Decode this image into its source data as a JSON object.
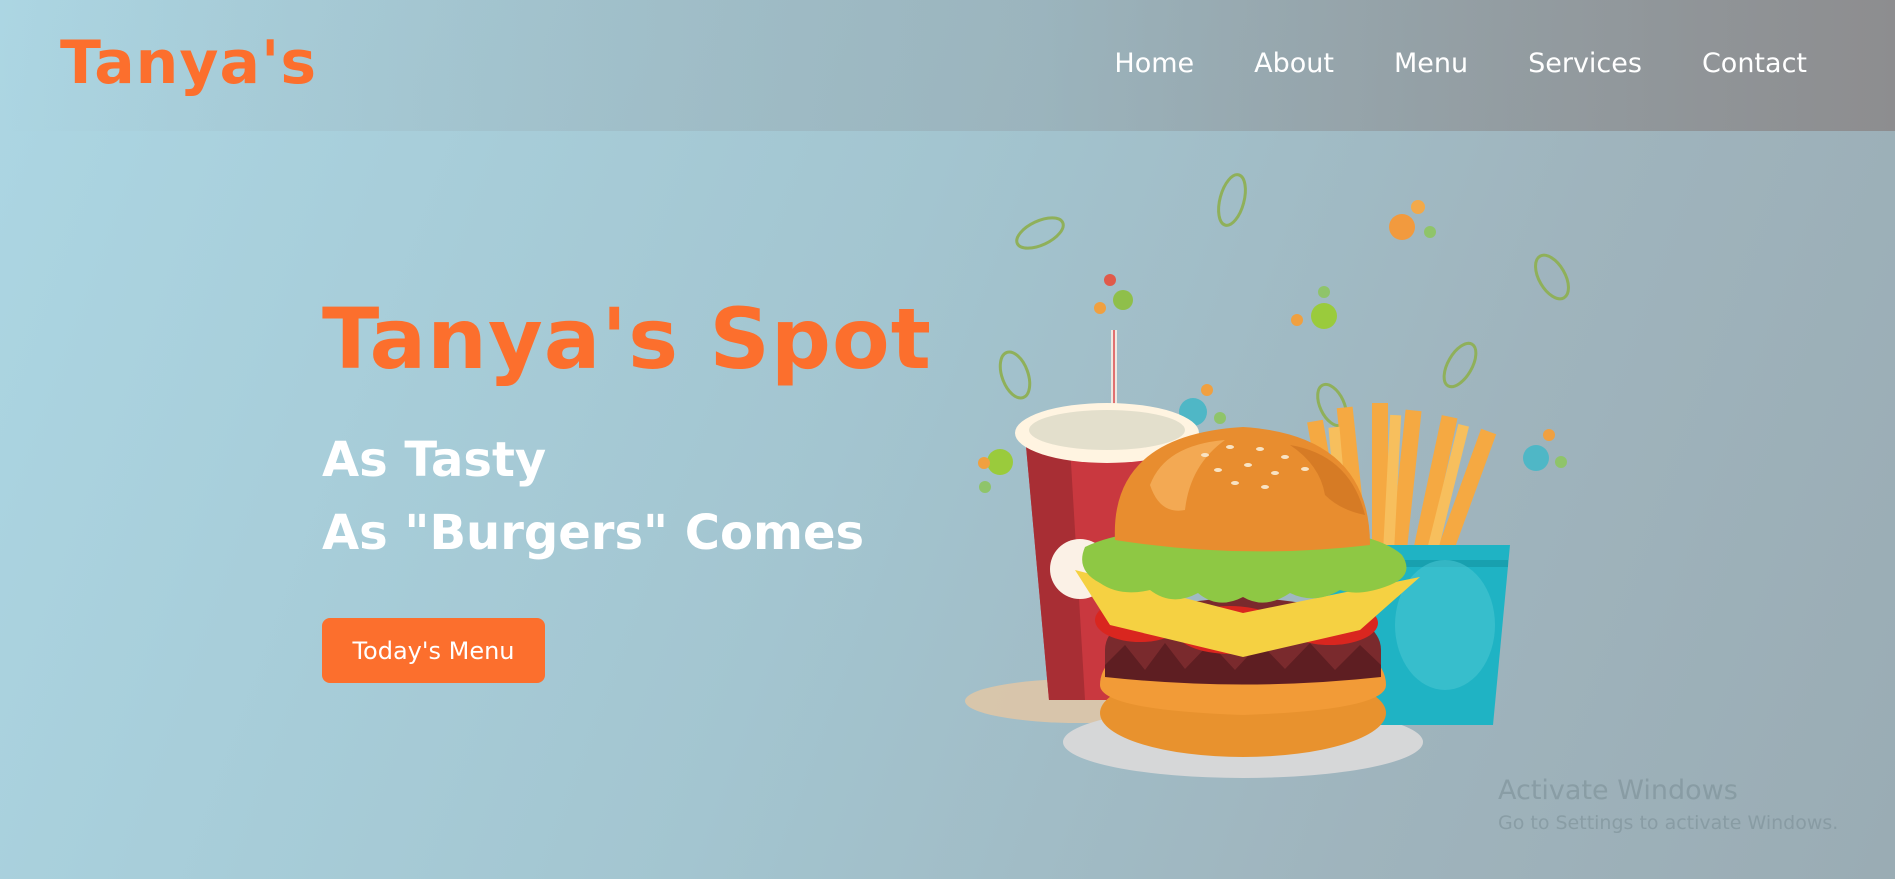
{
  "brand": {
    "logo_text": "Tanya's"
  },
  "nav": {
    "items": [
      {
        "label": "Home"
      },
      {
        "label": "About"
      },
      {
        "label": "Menu"
      },
      {
        "label": "Services"
      },
      {
        "label": "Contact"
      }
    ]
  },
  "hero": {
    "title": "Tanya's Spot",
    "line1": "As Tasty",
    "line2": "As \"Burgers\" Comes",
    "button_label": "Today's Menu",
    "image": "burger-drink-fries-icon"
  },
  "watermark": {
    "title": "Activate Windows",
    "subtitle": "Go to Settings to activate Windows."
  },
  "colors": {
    "accent": "#fc6f2d",
    "text_light": "#ffffff"
  }
}
